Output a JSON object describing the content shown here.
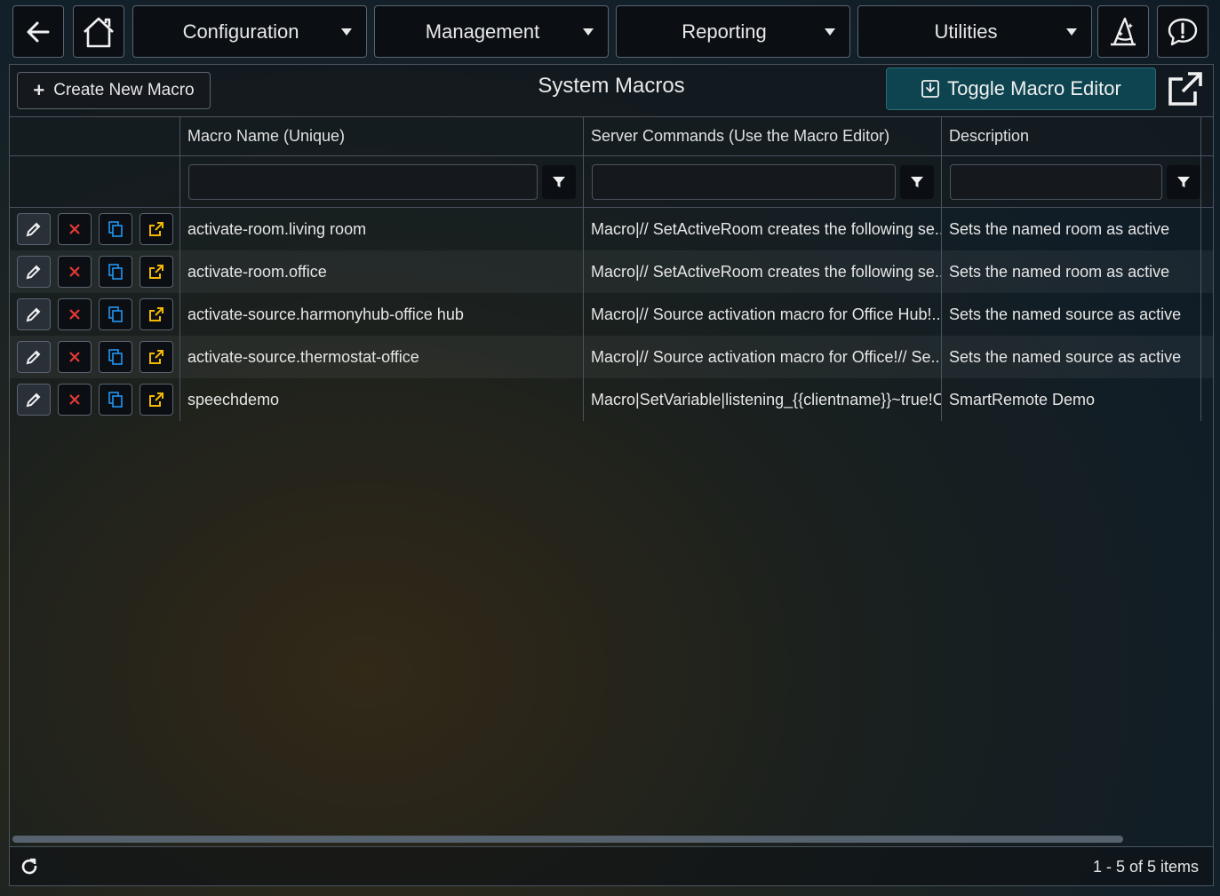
{
  "nav": {
    "menus": [
      {
        "label": "Configuration"
      },
      {
        "label": "Management"
      },
      {
        "label": "Reporting"
      },
      {
        "label": "Utilities"
      }
    ],
    "icons": {
      "back": "arrow-left-icon",
      "home": "home-icon",
      "wizard": "wizard-hat-icon",
      "feedback": "feedback-icon"
    }
  },
  "toolbar": {
    "create_label": "Create New Macro",
    "title": "System Macros",
    "toggle_label": "Toggle Macro Editor"
  },
  "grid": {
    "columns": [
      "Macro Name (Unique)",
      "Server Commands (Use the Macro Editor)",
      "Description"
    ],
    "rows": [
      {
        "name": "activate-room.living room",
        "commands": "Macro|// SetActiveRoom creates the following se...",
        "description": "Sets the named room as active"
      },
      {
        "name": "activate-room.office",
        "commands": "Macro|// SetActiveRoom creates the following se...",
        "description": "Sets the named room as active"
      },
      {
        "name": "activate-source.harmonyhub-office hub",
        "commands": "Macro|// Source activation macro for Office Hub!...",
        "description": "Sets the named source as active"
      },
      {
        "name": "activate-source.thermostat-office",
        "commands": "Macro|// Source activation macro for Office!// Se...",
        "description": "Sets the named source as active"
      },
      {
        "name": "speechdemo",
        "commands": "Macro|SetVariable|listening_{{clientname}}~true!C...",
        "description": "SmartRemote Demo"
      }
    ]
  },
  "footer": {
    "pager_info": "1 - 5 of 5 items"
  },
  "colors": {
    "delete": "#e53935",
    "copy": "#2196f3",
    "export": "#f5b800",
    "toggle_bg": "#0d4450"
  }
}
